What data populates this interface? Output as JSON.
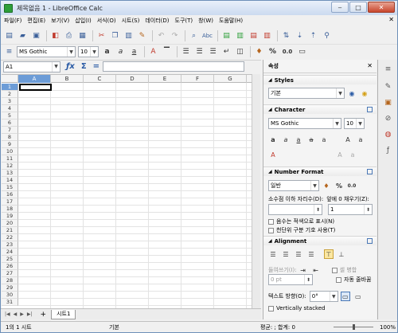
{
  "window": {
    "title": "제목없음 1 - LibreOffice Calc"
  },
  "menu": [
    "파일(F)",
    "편집(E)",
    "보기(V)",
    "삽입(I)",
    "서식(O)",
    "시트(S)",
    "데이터(D)",
    "도구(T)",
    "창(W)",
    "도움말(H)"
  ],
  "toolbar": {
    "font_name": "MS Gothic",
    "font_size": "10",
    "percent_label": "%",
    "decimal_label": "0.0",
    "number_label": "0.0"
  },
  "formula_bar": {
    "cell_ref": "A1",
    "sum_symbol": "Σ",
    "equals_symbol": "=",
    "value": ""
  },
  "grid": {
    "columns": [
      "A",
      "B",
      "C",
      "D",
      "E",
      "F",
      "G"
    ],
    "rows": [
      "1",
      "2",
      "3",
      "4",
      "5",
      "6",
      "7",
      "8",
      "9",
      "10",
      "11",
      "12",
      "13",
      "14",
      "15",
      "16",
      "17",
      "18",
      "19",
      "20",
      "21",
      "22",
      "23",
      "24",
      "25",
      "26",
      "27",
      "28",
      "29",
      "30",
      "31"
    ],
    "selected_column": "A",
    "selected_row": "1"
  },
  "sheet_tabs": [
    "시트1"
  ],
  "statusbar": {
    "sheet_info": "1의 1 시트",
    "page_style": "기본",
    "summary": "평균: ; 합계: 0",
    "zoom": "100%"
  },
  "sidebar": {
    "title": "속성",
    "styles": {
      "header": "Styles",
      "value": "기본"
    },
    "character": {
      "header": "Character",
      "font_name": "MS Gothic",
      "font_size": "10"
    },
    "number_format": {
      "header": "Number Format",
      "category": "일반",
      "decimal_label": "소수점 이하 자리수(D):",
      "decimal_value": "",
      "leading_zeros_label": "앞에 0 채우기(Z):",
      "leading_zeros_value": "1",
      "negative_red_label": "음수는 적색으로 표시(N)",
      "thousands_label": "천단위 구분 기호 사용(T)"
    },
    "alignment": {
      "header": "Alignment",
      "indent_label": "들여쓰기(I):",
      "merge_label": "셀 병합",
      "wrap_label": "자동 줄바꿈",
      "indent_value": "0 pt",
      "text_direction_label": "텍스트 방향(O):",
      "text_direction_value": "0°",
      "vertically_stacked_label": "Vertically stacked"
    }
  },
  "colors": {
    "selection": "#6c9cd7",
    "accent": "#2a5ba5"
  }
}
